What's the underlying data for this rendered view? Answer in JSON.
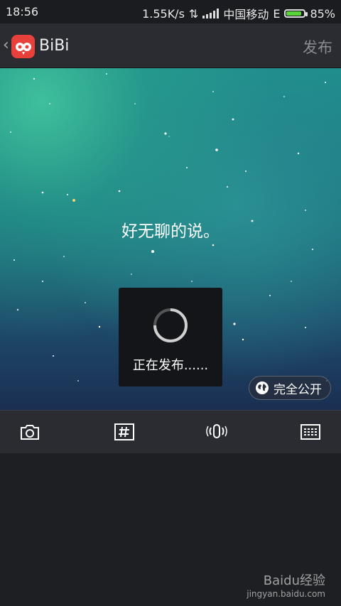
{
  "status_bar": {
    "time": "18:56",
    "speed": "1.55K/s",
    "carrier": "中国移动",
    "network": "E",
    "battery": "85%",
    "battery_level": 0.85
  },
  "header": {
    "app_name": "BiBi",
    "publish_label": "发布"
  },
  "post": {
    "text": "好无聊的说。"
  },
  "loading": {
    "text": "正在发布......"
  },
  "privacy": {
    "label": "完全公开"
  },
  "toolbar": {
    "items": [
      "camera-icon",
      "hashtag-icon",
      "voice-icon",
      "keyboard-icon"
    ]
  },
  "watermark": {
    "text": "Baidu经验",
    "url": "jingyan.baidu.com"
  },
  "colors": {
    "accent_red": "#e8403b",
    "battery_green": "#5ad33a"
  }
}
